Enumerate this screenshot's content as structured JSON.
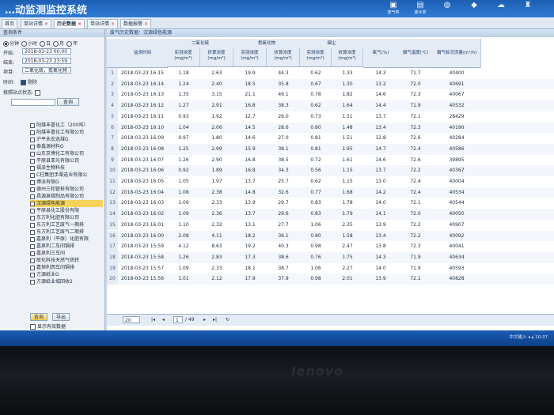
{
  "header": {
    "title": "…动监测监控系统",
    "icons": [
      {
        "name": "waste-gas-icon",
        "label": "废气类",
        "glyph": "▣"
      },
      {
        "name": "waste-water-icon",
        "label": "废水类",
        "glyph": "▤"
      },
      {
        "name": "noise-icon",
        "label": "",
        "glyph": "◍"
      },
      {
        "name": "monitor-icon",
        "label": "",
        "glyph": "◆"
      },
      {
        "name": "cloud-icon",
        "label": "",
        "glyph": "☁"
      },
      {
        "name": "chimney-icon",
        "label": "",
        "glyph": "♜"
      }
    ]
  },
  "tabs": [
    {
      "label": "首页",
      "closable": false
    },
    {
      "label": "单站详情",
      "closable": true
    },
    {
      "label": "历史数据",
      "closable": true,
      "active": true
    },
    {
      "label": "单站详情",
      "closable": true
    },
    {
      "label": "数据报警",
      "closable": true
    }
  ],
  "query": {
    "title": "查询条件",
    "periods": [
      "分钟",
      "小时",
      "日",
      "月",
      "年"
    ],
    "selected_period": "分钟",
    "start_label": "开始:",
    "start_value": "2018-03-23 00:00",
    "end_label": "结束:",
    "end_value": "2018-03-23 23:59",
    "item_label": "项目:",
    "item_value": "二氧化硫，氮氧化物",
    "time_label": "时间:",
    "reject_label": "剔除",
    "filter_label": "按照站点状态:",
    "search_button": "查询",
    "tree": [
      "阳煤丰喜化工（200吨）",
      "阳煤丰喜化工有限公司",
      "沪平永宏选煤G",
      "泰鑫源材料G",
      "山东京博化工有限公司",
      "平原县亚光有限公司",
      "福泽生物科技",
      "C柱集团手渠选业有限公",
      "博派有限G",
      "德州三和管桩有限公司",
      "昌源泉碳制品有限公司",
      "汉源绿色能源",
      "平原县化工股份有限",
      "东方利化肥有限公司",
      "东方利工艺废气一期排",
      "东方利工艺废气二期排",
      "嘉泉利（平原）化肥有限",
      "嘉泉利二车间锅排",
      "嘉泉利三车间",
      "联化科技天然气热转",
      "嘉恒利西车间锅排",
      "方源纸业G",
      "方源纸业城回收2"
    ],
    "selected_index": 11,
    "query_button": "查询",
    "export_button": "导出",
    "show_valid_label": "显示有效数据"
  },
  "main": {
    "title": "废气历史数据：汉源绿色能源",
    "group_headers": [
      "二氧化硫",
      "氮氧化物",
      "烟尘"
    ],
    "columns": {
      "time": "监测时间",
      "real": "实测浓度\n(mg/m³)",
      "conv": "折算浓度\n(mg/m³)",
      "o2": "氧气(%)",
      "temp": "烟气温度(℃)",
      "flow": "烟气标况流量(m³/h)"
    },
    "rows": [
      {
        "n": "1",
        "t": "2018-03-23 16:15",
        "so2r": "1.18",
        "so2c": "2.63",
        "noxr": "19.9",
        "noxc": "44.3",
        "dr": "0.62",
        "dc": "1.33",
        "o2": "14.3",
        "tmp": "71.7",
        "flow": "40400"
      },
      {
        "n": "2",
        "t": "2018-03-23 16:14",
        "so2r": "1.24",
        "so2c": "2.40",
        "noxr": "18.5",
        "noxc": "35.8",
        "dr": "0.67",
        "dc": "1.30",
        "o2": "13.2",
        "tmp": "72.0",
        "flow": "40691"
      },
      {
        "n": "3",
        "t": "2018-03-23 16:13",
        "so2r": "1.35",
        "so2c": "3.15",
        "noxr": "21.1",
        "noxc": "49.1",
        "dr": "0.78",
        "dc": "1.82",
        "o2": "14.6",
        "tmp": "72.3",
        "flow": "40067"
      },
      {
        "n": "4",
        "t": "2018-03-23 16:12",
        "so2r": "1.27",
        "so2c": "2.91",
        "noxr": "16.8",
        "noxc": "38.3",
        "dr": "0.62",
        "dc": "1.64",
        "o2": "14.4",
        "tmp": "71.9",
        "flow": "40532"
      },
      {
        "n": "5",
        "t": "2018-03-23 16:11",
        "so2r": "0.93",
        "so2c": "1.92",
        "noxr": "12.7",
        "noxc": "26.0",
        "dr": "0.73",
        "dc": "1.51",
        "o2": "13.7",
        "tmp": "72.1",
        "flow": "28429"
      },
      {
        "n": "6",
        "t": "2018-03-23 16:10",
        "so2r": "1.04",
        "so2c": "2.06",
        "noxr": "14.5",
        "noxc": "28.6",
        "dr": "0.80",
        "dc": "1.48",
        "o2": "13.4",
        "tmp": "72.3",
        "flow": "40190"
      },
      {
        "n": "7",
        "t": "2018-03-23 16:09",
        "so2r": "0.97",
        "so2c": "1.80",
        "noxr": "14.6",
        "noxc": "27.0",
        "dr": "0.81",
        "dc": "1.51",
        "o2": "12.8",
        "tmp": "72.6",
        "flow": "40284"
      },
      {
        "n": "8",
        "t": "2018-03-23 16:08",
        "so2r": "1.25",
        "so2c": "2.99",
        "noxr": "15.9",
        "noxc": "38.1",
        "dr": "0.81",
        "dc": "1.95",
        "o2": "14.7",
        "tmp": "72.4",
        "flow": "40586"
      },
      {
        "n": "9",
        "t": "2018-03-23 16:07",
        "so2r": "1.26",
        "so2c": "2.90",
        "noxr": "16.8",
        "noxc": "38.5",
        "dr": "0.72",
        "dc": "1.61",
        "o2": "14.6",
        "tmp": "72.6",
        "flow": "39895"
      },
      {
        "n": "10",
        "t": "2018-03-23 16:06",
        "so2r": "0.92",
        "so2c": "1.89",
        "noxr": "16.8",
        "noxc": "34.3",
        "dr": "0.56",
        "dc": "1.15",
        "o2": "13.7",
        "tmp": "72.2",
        "flow": "40367"
      },
      {
        "n": "11",
        "t": "2018-03-23 16:05",
        "so2r": "1.05",
        "so2c": "1.97",
        "noxr": "13.7",
        "noxc": "25.7",
        "dr": "0.62",
        "dc": "1.15",
        "o2": "13.0",
        "tmp": "72.4",
        "flow": "40004"
      },
      {
        "n": "12",
        "t": "2018-03-23 16:04",
        "so2r": "1.08",
        "so2c": "2.38",
        "noxr": "14.8",
        "noxc": "32.6",
        "dr": "0.77",
        "dc": "1.68",
        "o2": "14.2",
        "tmp": "72.4",
        "flow": "40534"
      },
      {
        "n": "13",
        "t": "2018-03-23 16:03",
        "so2r": "1.09",
        "so2c": "2.33",
        "noxr": "13.9",
        "noxc": "29.7",
        "dr": "0.83",
        "dc": "1.78",
        "o2": "14.0",
        "tmp": "72.1",
        "flow": "40544"
      },
      {
        "n": "14",
        "t": "2018-03-23 16:02",
        "so2r": "1.09",
        "so2c": "2.36",
        "noxr": "13.7",
        "noxc": "29.6",
        "dr": "0.83",
        "dc": "1.79",
        "o2": "14.1",
        "tmp": "72.0",
        "flow": "40050"
      },
      {
        "n": "15",
        "t": "2018-03-23 16:01",
        "so2r": "1.10",
        "so2c": "2.32",
        "noxr": "13.1",
        "noxc": "27.7",
        "dr": "1.06",
        "dc": "2.35",
        "o2": "13.9",
        "tmp": "72.2",
        "flow": "40907"
      },
      {
        "n": "16",
        "t": "2018-03-23 16:00",
        "so2r": "2.08",
        "so2c": "4.11",
        "noxr": "18.2",
        "noxc": "36.1",
        "dr": "0.80",
        "dc": "1.58",
        "o2": "13.4",
        "tmp": "72.2",
        "flow": "40092"
      },
      {
        "n": "17",
        "t": "2018-03-23 15:59",
        "so2r": "4.12",
        "so2c": "8.63",
        "noxr": "19.2",
        "noxc": "40.3",
        "dr": "0.98",
        "dc": "2.47",
        "o2": "13.8",
        "tmp": "72.3",
        "flow": "40041"
      },
      {
        "n": "18",
        "t": "2018-03-23 15:58",
        "so2r": "1.26",
        "so2c": "2.83",
        "noxr": "17.3",
        "noxc": "38.6",
        "dr": "0.76",
        "dc": "1.75",
        "o2": "14.3",
        "tmp": "71.9",
        "flow": "40634"
      },
      {
        "n": "19",
        "t": "2018-03-23 15:57",
        "so2r": "1.09",
        "so2c": "2.33",
        "noxr": "18.1",
        "noxc": "38.7",
        "dr": "1.06",
        "dc": "2.27",
        "o2": "14.0",
        "tmp": "71.9",
        "flow": "40593"
      },
      {
        "n": "20",
        "t": "2018-03-23 15:56",
        "so2r": "1.01",
        "so2c": "2.12",
        "noxr": "17.9",
        "noxc": "37.9",
        "dr": "0.98",
        "dc": "2.01",
        "o2": "13.9",
        "tmp": "72.1",
        "flow": "40828"
      }
    ]
  },
  "pager": {
    "page_size": "20",
    "page": "1",
    "total_pages": "/ 49"
  },
  "brand": "lenovo",
  "taskbar": {
    "items": "中文输入 ◂ ▴ 10:37"
  }
}
